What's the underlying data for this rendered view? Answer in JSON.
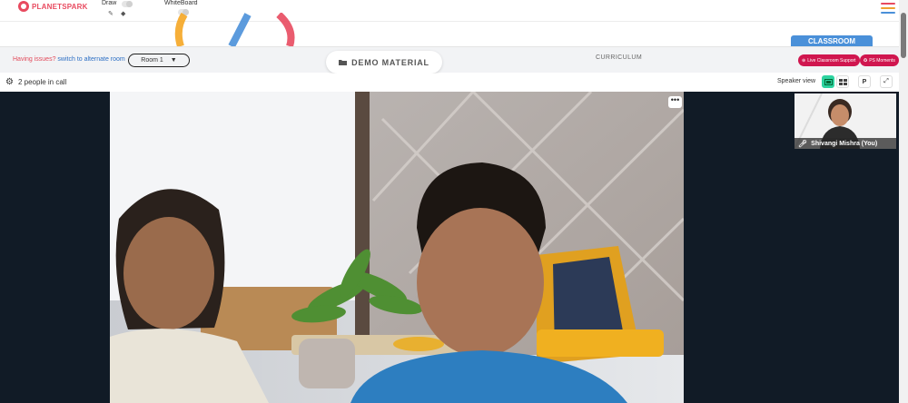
{
  "brand": {
    "name": "PLANETSPARK"
  },
  "top_tools": {
    "draw_label": "Draw",
    "whiteboard_label": "WhiteBoard"
  },
  "toolbar": {
    "issue_text": "Having issues?",
    "switch_link": "switch to alternate room",
    "room_value": "Room 1",
    "demo_label": "DEMO MATERIAL",
    "curriculum_label": "CURRICULUM",
    "classroom_tab": "CLASSROOM",
    "live_support_label": "Live Classroom Support",
    "ps_moments_label": "PS Moments"
  },
  "call": {
    "people_count": "2 people in call",
    "view_mode_label": "Speaker view",
    "view_buttons": [
      "speaker-view-icon",
      "grid-view-icon",
      "P",
      "fullscreen-icon"
    ]
  },
  "participants": {
    "self_name": "Shivangi Mishra (You)"
  },
  "colors": {
    "brand_red": "#e84a5f",
    "pill_red": "#d0164f",
    "classroom_blue": "#4a90d9",
    "active_green": "#2ed3a0",
    "stage_bg": "#111b26"
  }
}
